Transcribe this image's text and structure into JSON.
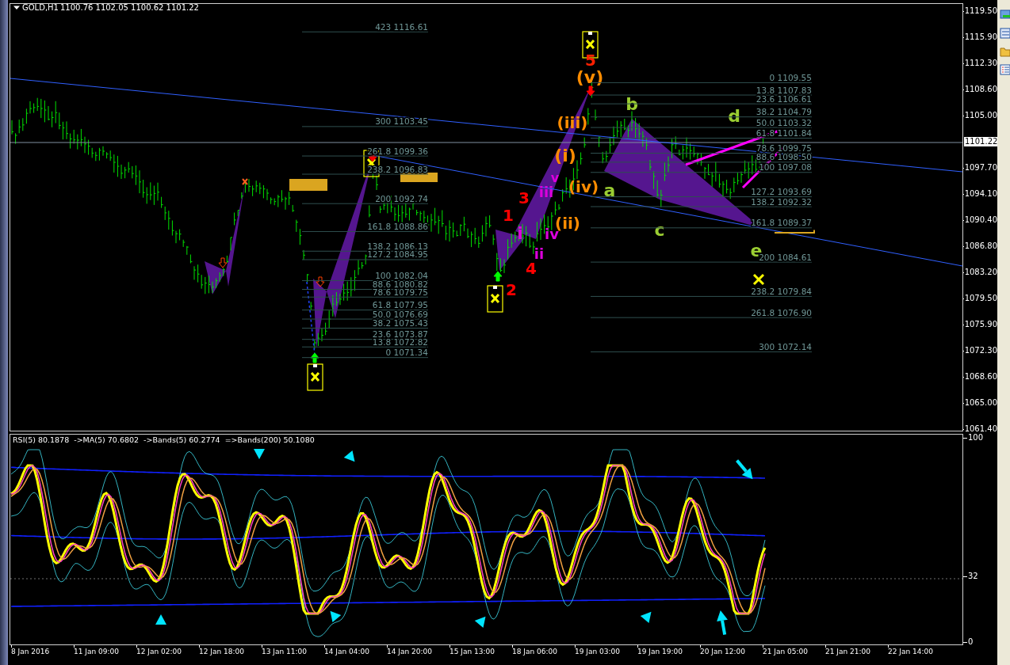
{
  "chart": {
    "symbol": "GOLD,H1",
    "ohlc": "1100.76 1102.05 1100.62 1101.22"
  },
  "price_axis": {
    "ticks": [
      "1119.50",
      "1115.90",
      "1112.30",
      "1108.60",
      "1105.00",
      "1097.70",
      "1094.10",
      "1090.40",
      "1086.80",
      "1083.20",
      "1079.50",
      "1075.90",
      "1072.30",
      "1068.60",
      "1065.00",
      "1061.40"
    ],
    "current": "1101.22"
  },
  "fib_left": [
    {
      "level": "423",
      "price": "1116.61"
    },
    {
      "level": "300",
      "price": "1103.45"
    },
    {
      "level": "261.8",
      "price": "1099.36"
    },
    {
      "level": "238.2",
      "price": "1096.83"
    },
    {
      "level": "200",
      "price": "1092.74"
    },
    {
      "level": "161.8",
      "price": "1088.86"
    },
    {
      "level": "138.2",
      "price": "1086.13"
    },
    {
      "level": "127.2",
      "price": "1084.95"
    },
    {
      "level": "100",
      "price": "1082.04"
    },
    {
      "level": "88.6",
      "price": "1080.82"
    },
    {
      "level": "78.6",
      "price": "1079.75"
    },
    {
      "level": "61.8",
      "price": "1077.95"
    },
    {
      "level": "50.0",
      "price": "1076.69"
    },
    {
      "level": "38.2",
      "price": "1075.43"
    },
    {
      "level": "23.6",
      "price": "1073.87"
    },
    {
      "level": "13.8",
      "price": "1072.82"
    },
    {
      "level": "0",
      "price": "1071.34"
    }
  ],
  "fib_right": [
    {
      "level": "0",
      "price": "1109.55"
    },
    {
      "level": "13.8",
      "price": "1107.83"
    },
    {
      "level": "23.6",
      "price": "1106.61"
    },
    {
      "level": "38.2",
      "price": "1104.79"
    },
    {
      "level": "50.0",
      "price": "1103.32"
    },
    {
      "level": "61.8",
      "price": "1101.84"
    },
    {
      "level": "78.6",
      "price": "1099.75"
    },
    {
      "level": "88.6",
      "price": "1098.50"
    },
    {
      "level": "100",
      "price": "1097.08"
    },
    {
      "level": "127.2",
      "price": "1093.69"
    },
    {
      "level": "138.2",
      "price": "1092.32"
    },
    {
      "level": "161.8",
      "price": "1089.37"
    },
    {
      "level": "200",
      "price": "1084.61"
    },
    {
      "level": "238.2",
      "price": "1079.84"
    },
    {
      "level": "261.8",
      "price": "1076.90"
    },
    {
      "level": "300",
      "price": "1072.14"
    }
  ],
  "wave_labels": [
    {
      "text": "5",
      "color": "#ff2000"
    },
    {
      "text": "(v)",
      "color": "#ff8c00"
    },
    {
      "text": "b",
      "color": "#9acd32"
    },
    {
      "text": "d",
      "color": "#9acd32"
    },
    {
      "text": "(iii)",
      "color": "#ff8c00"
    },
    {
      "text": "(i)",
      "color": "#ff8c00"
    },
    {
      "text": "v",
      "color": "#dd00dd"
    },
    {
      "text": "3",
      "color": "#ff0000"
    },
    {
      "text": "iii",
      "color": "#dd00dd"
    },
    {
      "text": "(iv)",
      "color": "#ff8c00"
    },
    {
      "text": "a",
      "color": "#9acd32"
    },
    {
      "text": "1",
      "color": "#ff0000"
    },
    {
      "text": "i",
      "color": "#dd00dd"
    },
    {
      "text": "iv",
      "color": "#dd00dd"
    },
    {
      "text": "(ii)",
      "color": "#ff8c00"
    },
    {
      "text": "c",
      "color": "#9acd32"
    },
    {
      "text": "ii",
      "color": "#dd00dd"
    },
    {
      "text": "e",
      "color": "#9acd32"
    },
    {
      "text": "4",
      "color": "#ff0000"
    },
    {
      "text": "2",
      "color": "#ff0000"
    }
  ],
  "indicator": {
    "header": "RSI(5) 80.1878  ->MA(5) 70.6802  ->Bands(5) 60.2774  =>Bands(200) 50.1080",
    "axis": [
      "100",
      "32",
      "0"
    ]
  },
  "time_axis": [
    "8 Jan 2016",
    "11 Jan 09:00",
    "12 Jan 02:00",
    "12 Jan 18:00",
    "13 Jan 11:00",
    "14 Jan 04:00",
    "14 Jan 20:00",
    "15 Jan 13:00",
    "18 Jan 06:00",
    "19 Jan 03:00",
    "19 Jan 19:00",
    "20 Jan 12:00",
    "21 Jan 05:00",
    "21 Jan 21:00",
    "22 Jan 14:00"
  ]
}
